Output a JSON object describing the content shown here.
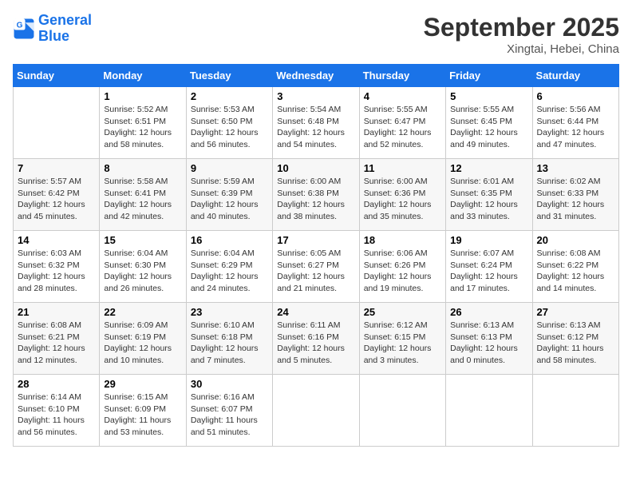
{
  "header": {
    "logo_line1": "General",
    "logo_line2": "Blue",
    "month_title": "September 2025",
    "subtitle": "Xingtai, Hebei, China"
  },
  "days_of_week": [
    "Sunday",
    "Monday",
    "Tuesday",
    "Wednesday",
    "Thursday",
    "Friday",
    "Saturday"
  ],
  "weeks": [
    [
      {
        "num": "",
        "info": ""
      },
      {
        "num": "1",
        "info": "Sunrise: 5:52 AM\nSunset: 6:51 PM\nDaylight: 12 hours\nand 58 minutes."
      },
      {
        "num": "2",
        "info": "Sunrise: 5:53 AM\nSunset: 6:50 PM\nDaylight: 12 hours\nand 56 minutes."
      },
      {
        "num": "3",
        "info": "Sunrise: 5:54 AM\nSunset: 6:48 PM\nDaylight: 12 hours\nand 54 minutes."
      },
      {
        "num": "4",
        "info": "Sunrise: 5:55 AM\nSunset: 6:47 PM\nDaylight: 12 hours\nand 52 minutes."
      },
      {
        "num": "5",
        "info": "Sunrise: 5:55 AM\nSunset: 6:45 PM\nDaylight: 12 hours\nand 49 minutes."
      },
      {
        "num": "6",
        "info": "Sunrise: 5:56 AM\nSunset: 6:44 PM\nDaylight: 12 hours\nand 47 minutes."
      }
    ],
    [
      {
        "num": "7",
        "info": "Sunrise: 5:57 AM\nSunset: 6:42 PM\nDaylight: 12 hours\nand 45 minutes."
      },
      {
        "num": "8",
        "info": "Sunrise: 5:58 AM\nSunset: 6:41 PM\nDaylight: 12 hours\nand 42 minutes."
      },
      {
        "num": "9",
        "info": "Sunrise: 5:59 AM\nSunset: 6:39 PM\nDaylight: 12 hours\nand 40 minutes."
      },
      {
        "num": "10",
        "info": "Sunrise: 6:00 AM\nSunset: 6:38 PM\nDaylight: 12 hours\nand 38 minutes."
      },
      {
        "num": "11",
        "info": "Sunrise: 6:00 AM\nSunset: 6:36 PM\nDaylight: 12 hours\nand 35 minutes."
      },
      {
        "num": "12",
        "info": "Sunrise: 6:01 AM\nSunset: 6:35 PM\nDaylight: 12 hours\nand 33 minutes."
      },
      {
        "num": "13",
        "info": "Sunrise: 6:02 AM\nSunset: 6:33 PM\nDaylight: 12 hours\nand 31 minutes."
      }
    ],
    [
      {
        "num": "14",
        "info": "Sunrise: 6:03 AM\nSunset: 6:32 PM\nDaylight: 12 hours\nand 28 minutes."
      },
      {
        "num": "15",
        "info": "Sunrise: 6:04 AM\nSunset: 6:30 PM\nDaylight: 12 hours\nand 26 minutes."
      },
      {
        "num": "16",
        "info": "Sunrise: 6:04 AM\nSunset: 6:29 PM\nDaylight: 12 hours\nand 24 minutes."
      },
      {
        "num": "17",
        "info": "Sunrise: 6:05 AM\nSunset: 6:27 PM\nDaylight: 12 hours\nand 21 minutes."
      },
      {
        "num": "18",
        "info": "Sunrise: 6:06 AM\nSunset: 6:26 PM\nDaylight: 12 hours\nand 19 minutes."
      },
      {
        "num": "19",
        "info": "Sunrise: 6:07 AM\nSunset: 6:24 PM\nDaylight: 12 hours\nand 17 minutes."
      },
      {
        "num": "20",
        "info": "Sunrise: 6:08 AM\nSunset: 6:22 PM\nDaylight: 12 hours\nand 14 minutes."
      }
    ],
    [
      {
        "num": "21",
        "info": "Sunrise: 6:08 AM\nSunset: 6:21 PM\nDaylight: 12 hours\nand 12 minutes."
      },
      {
        "num": "22",
        "info": "Sunrise: 6:09 AM\nSunset: 6:19 PM\nDaylight: 12 hours\nand 10 minutes."
      },
      {
        "num": "23",
        "info": "Sunrise: 6:10 AM\nSunset: 6:18 PM\nDaylight: 12 hours\nand 7 minutes."
      },
      {
        "num": "24",
        "info": "Sunrise: 6:11 AM\nSunset: 6:16 PM\nDaylight: 12 hours\nand 5 minutes."
      },
      {
        "num": "25",
        "info": "Sunrise: 6:12 AM\nSunset: 6:15 PM\nDaylight: 12 hours\nand 3 minutes."
      },
      {
        "num": "26",
        "info": "Sunrise: 6:13 AM\nSunset: 6:13 PM\nDaylight: 12 hours\nand 0 minutes."
      },
      {
        "num": "27",
        "info": "Sunrise: 6:13 AM\nSunset: 6:12 PM\nDaylight: 11 hours\nand 58 minutes."
      }
    ],
    [
      {
        "num": "28",
        "info": "Sunrise: 6:14 AM\nSunset: 6:10 PM\nDaylight: 11 hours\nand 56 minutes."
      },
      {
        "num": "29",
        "info": "Sunrise: 6:15 AM\nSunset: 6:09 PM\nDaylight: 11 hours\nand 53 minutes."
      },
      {
        "num": "30",
        "info": "Sunrise: 6:16 AM\nSunset: 6:07 PM\nDaylight: 11 hours\nand 51 minutes."
      },
      {
        "num": "",
        "info": ""
      },
      {
        "num": "",
        "info": ""
      },
      {
        "num": "",
        "info": ""
      },
      {
        "num": "",
        "info": ""
      }
    ]
  ]
}
